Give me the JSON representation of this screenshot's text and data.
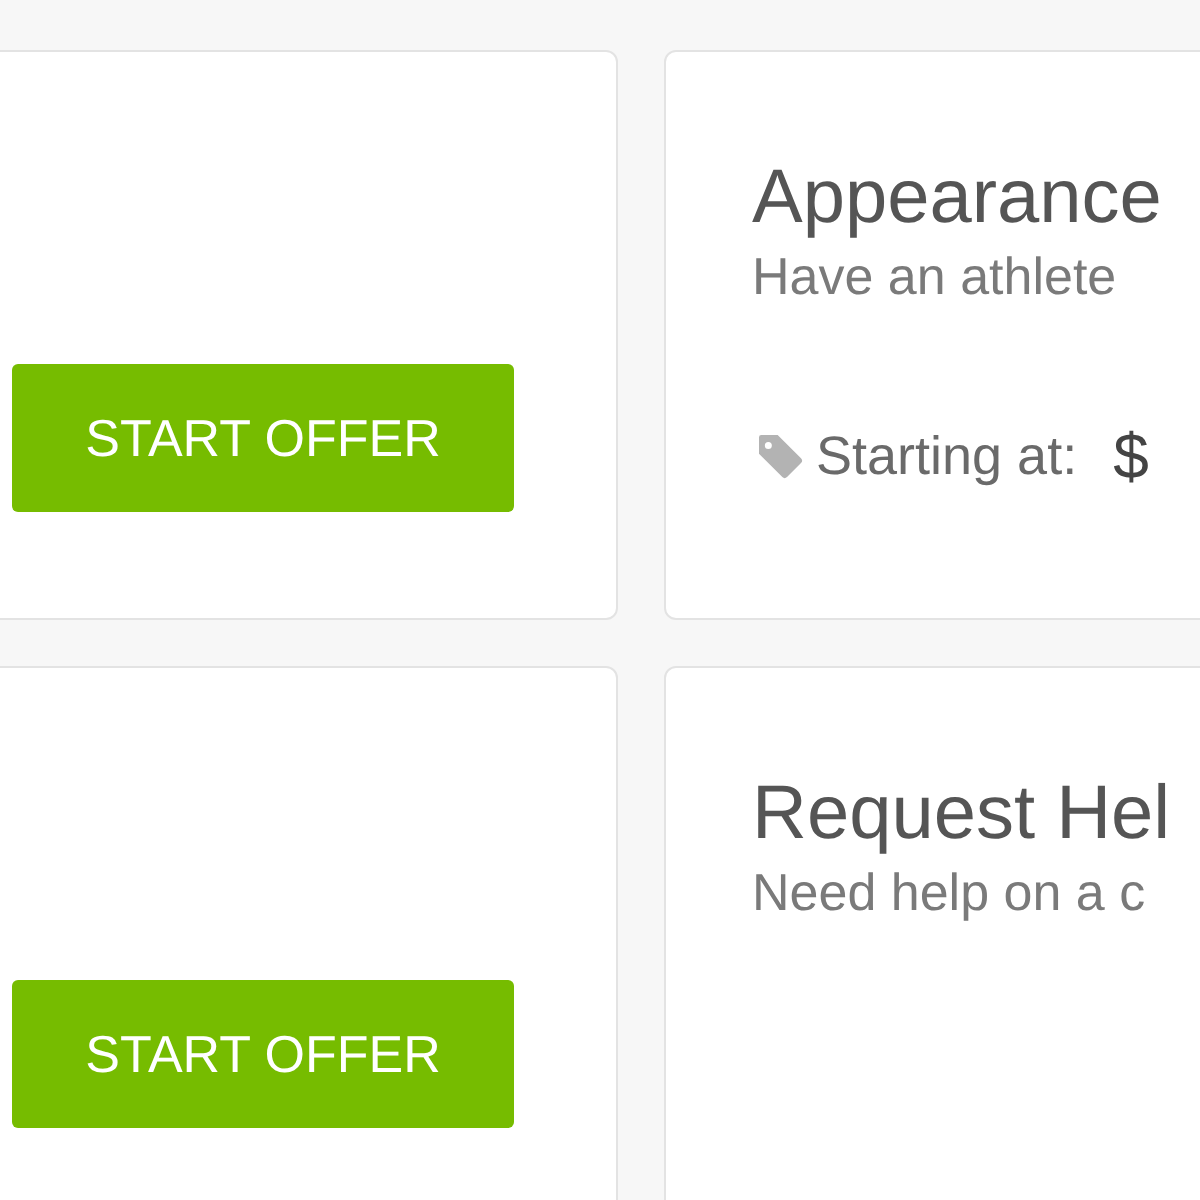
{
  "cards": [
    {
      "kind": "offer",
      "button": "START OFFER"
    },
    {
      "kind": "service",
      "title": "Appearance",
      "description": "Have an athlete",
      "price_label": "Starting at:",
      "price": "$"
    },
    {
      "kind": "offer",
      "button": "START OFFER"
    },
    {
      "kind": "service",
      "title": "Request Hel",
      "description": "Need help on a c"
    }
  ]
}
